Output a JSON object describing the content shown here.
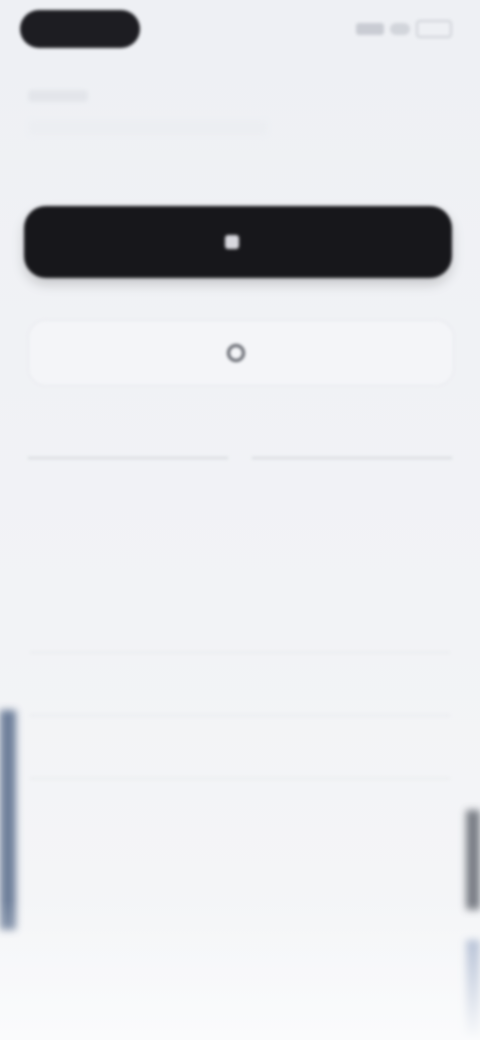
{
  "status_bar": {
    "time": "",
    "indicators": [
      "signal-icon",
      "wifi-icon",
      "battery-icon"
    ]
  },
  "header": {
    "caption": "",
    "title": ""
  },
  "primary_action": {
    "label": "",
    "icon": "apple-icon",
    "color": "#17171b"
  },
  "secondary_action": {
    "label": "",
    "icon": "google-icon"
  },
  "divider": {
    "text": ""
  },
  "form": {
    "section_title": "",
    "fields": [
      {
        "placeholder": ""
      },
      {
        "placeholder": ""
      },
      {
        "placeholder": ""
      }
    ]
  },
  "notice": {
    "text": ""
  }
}
